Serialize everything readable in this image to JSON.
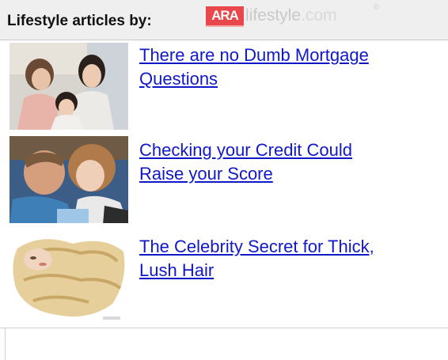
{
  "header": {
    "title": "Lifestyle articles by:",
    "logo": {
      "ara": "ARA",
      "lifestyle": "lifestyle",
      "dotcom": ".com",
      "mark": "®"
    }
  },
  "articles": [
    {
      "title_line1": "There are no Dumb Mortgage",
      "title_line2": "Questions",
      "thumb": "family-photo"
    },
    {
      "title_line1": "Checking your Credit Could",
      "title_line2": "Raise your Score",
      "thumb": "couple-computer-photo"
    },
    {
      "title_line1": "The Celebrity Secret for Thick,",
      "title_line2": "Lush Hair",
      "thumb": "blonde-hair-photo"
    }
  ],
  "colors": {
    "link": "#1018c8",
    "header_bg": "#efefef",
    "ara_red": "#e8474b",
    "logo_gray": "#c9c9c9"
  }
}
